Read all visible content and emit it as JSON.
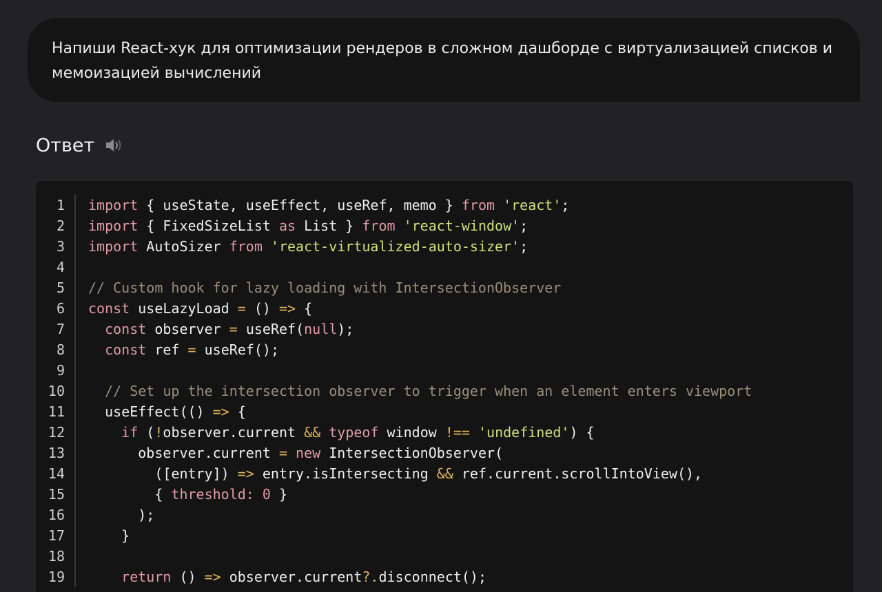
{
  "prompt": {
    "line1": "Напиши React-хук для оптимизации рендеров в сложном дашборде с виртуализацией списков и",
    "line2": "мемоизацией вычислений"
  },
  "answer": {
    "title": "Ответ",
    "speaker_icon": "speaker-icon"
  },
  "code": {
    "language": "javascript",
    "lines": [
      {
        "num": "1",
        "tokens": [
          [
            "kw",
            "import"
          ],
          [
            "plain",
            " { useState, useEffect, useRef, memo } "
          ],
          [
            "kw",
            "from"
          ],
          [
            "plain",
            " "
          ],
          [
            "str",
            "'react'"
          ],
          [
            "plain",
            ";"
          ]
        ]
      },
      {
        "num": "2",
        "tokens": [
          [
            "kw",
            "import"
          ],
          [
            "plain",
            " { FixedSizeList "
          ],
          [
            "kw",
            "as"
          ],
          [
            "plain",
            " List } "
          ],
          [
            "kw",
            "from"
          ],
          [
            "plain",
            " "
          ],
          [
            "str",
            "'react-window'"
          ],
          [
            "plain",
            ";"
          ]
        ]
      },
      {
        "num": "3",
        "tokens": [
          [
            "kw",
            "import"
          ],
          [
            "plain",
            " AutoSizer "
          ],
          [
            "kw",
            "from"
          ],
          [
            "plain",
            " "
          ],
          [
            "str",
            "'react-virtualized-auto-sizer'"
          ],
          [
            "plain",
            ";"
          ]
        ]
      },
      {
        "num": "4",
        "tokens": []
      },
      {
        "num": "5",
        "tokens": [
          [
            "com",
            "// Custom hook for lazy loading with IntersectionObserver"
          ]
        ]
      },
      {
        "num": "6",
        "tokens": [
          [
            "kw",
            "const"
          ],
          [
            "plain",
            " useLazyLoad "
          ],
          [
            "op",
            "="
          ],
          [
            "plain",
            " () "
          ],
          [
            "op",
            "=>"
          ],
          [
            "plain",
            " {"
          ]
        ]
      },
      {
        "num": "7",
        "tokens": [
          [
            "plain",
            "  "
          ],
          [
            "kw",
            "const"
          ],
          [
            "plain",
            " observer "
          ],
          [
            "op",
            "="
          ],
          [
            "plain",
            " useRef("
          ],
          [
            "kw",
            "null"
          ],
          [
            "plain",
            ");"
          ]
        ]
      },
      {
        "num": "8",
        "tokens": [
          [
            "plain",
            "  "
          ],
          [
            "kw",
            "const"
          ],
          [
            "plain",
            " ref "
          ],
          [
            "op",
            "="
          ],
          [
            "plain",
            " useRef();"
          ]
        ]
      },
      {
        "num": "9",
        "tokens": []
      },
      {
        "num": "10",
        "tokens": [
          [
            "plain",
            "  "
          ],
          [
            "com",
            "// Set up the intersection observer to trigger when an element enters viewport"
          ]
        ]
      },
      {
        "num": "11",
        "tokens": [
          [
            "plain",
            "  useEffect(() "
          ],
          [
            "op",
            "=>"
          ],
          [
            "plain",
            " {"
          ]
        ]
      },
      {
        "num": "12",
        "tokens": [
          [
            "plain",
            "    "
          ],
          [
            "kw",
            "if"
          ],
          [
            "plain",
            " ("
          ],
          [
            "op",
            "!"
          ],
          [
            "plain",
            "observer.current "
          ],
          [
            "op",
            "&&"
          ],
          [
            "plain",
            " "
          ],
          [
            "kw",
            "typeof"
          ],
          [
            "plain",
            " window "
          ],
          [
            "op",
            "!=="
          ],
          [
            "plain",
            " "
          ],
          [
            "str",
            "'undefined'"
          ],
          [
            "plain",
            ") {"
          ]
        ]
      },
      {
        "num": "13",
        "tokens": [
          [
            "plain",
            "      observer.current "
          ],
          [
            "op",
            "="
          ],
          [
            "plain",
            " "
          ],
          [
            "kw",
            "new"
          ],
          [
            "plain",
            " IntersectionObserver("
          ]
        ]
      },
      {
        "num": "14",
        "tokens": [
          [
            "plain",
            "        ([entry]) "
          ],
          [
            "op",
            "=>"
          ],
          [
            "plain",
            " entry.isIntersecting "
          ],
          [
            "op",
            "&&"
          ],
          [
            "plain",
            " ref.current.scrollIntoView(),"
          ]
        ]
      },
      {
        "num": "15",
        "tokens": [
          [
            "plain",
            "        { "
          ],
          [
            "prop",
            "threshold:"
          ],
          [
            "plain",
            " "
          ],
          [
            "kw",
            "0"
          ],
          [
            "plain",
            " }"
          ]
        ]
      },
      {
        "num": "16",
        "tokens": [
          [
            "plain",
            "      );"
          ]
        ]
      },
      {
        "num": "17",
        "tokens": [
          [
            "plain",
            "    }"
          ]
        ]
      },
      {
        "num": "18",
        "tokens": []
      },
      {
        "num": "19",
        "tokens": [
          [
            "plain",
            "    "
          ],
          [
            "kw",
            "return"
          ],
          [
            "plain",
            " () "
          ],
          [
            "op",
            "=>"
          ],
          [
            "plain",
            " observer.current"
          ],
          [
            "op",
            "?."
          ],
          [
            "plain",
            "disconnect();"
          ]
        ]
      }
    ]
  },
  "colors": {
    "background": "#222224",
    "bubble": "#141414",
    "code_bg": "#141414",
    "keyword": "#e29aa6",
    "string": "#cde07a",
    "comment": "#9c8d7a",
    "operator": "#e2b35a"
  }
}
